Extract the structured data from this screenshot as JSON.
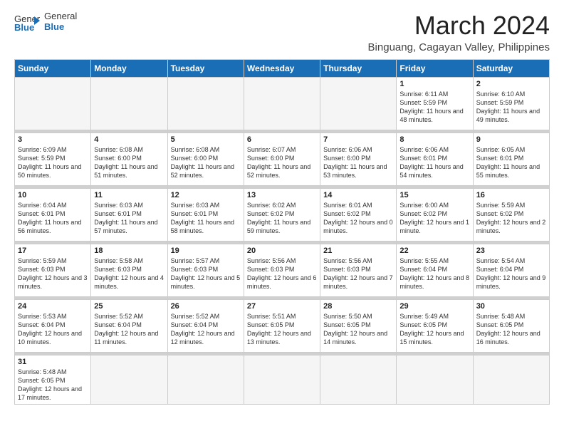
{
  "header": {
    "logo_general": "General",
    "logo_blue": "Blue",
    "month_title": "March 2024",
    "location": "Binguang, Cagayan Valley, Philippines"
  },
  "weekdays": [
    "Sunday",
    "Monday",
    "Tuesday",
    "Wednesday",
    "Thursday",
    "Friday",
    "Saturday"
  ],
  "weeks": [
    [
      {
        "day": "",
        "info": ""
      },
      {
        "day": "",
        "info": ""
      },
      {
        "day": "",
        "info": ""
      },
      {
        "day": "",
        "info": ""
      },
      {
        "day": "",
        "info": ""
      },
      {
        "day": "1",
        "info": "Sunrise: 6:11 AM\nSunset: 5:59 PM\nDaylight: 11 hours and 48 minutes."
      },
      {
        "day": "2",
        "info": "Sunrise: 6:10 AM\nSunset: 5:59 PM\nDaylight: 11 hours and 49 minutes."
      }
    ],
    [
      {
        "day": "3",
        "info": "Sunrise: 6:09 AM\nSunset: 5:59 PM\nDaylight: 11 hours and 50 minutes."
      },
      {
        "day": "4",
        "info": "Sunrise: 6:08 AM\nSunset: 6:00 PM\nDaylight: 11 hours and 51 minutes."
      },
      {
        "day": "5",
        "info": "Sunrise: 6:08 AM\nSunset: 6:00 PM\nDaylight: 11 hours and 52 minutes."
      },
      {
        "day": "6",
        "info": "Sunrise: 6:07 AM\nSunset: 6:00 PM\nDaylight: 11 hours and 52 minutes."
      },
      {
        "day": "7",
        "info": "Sunrise: 6:06 AM\nSunset: 6:00 PM\nDaylight: 11 hours and 53 minutes."
      },
      {
        "day": "8",
        "info": "Sunrise: 6:06 AM\nSunset: 6:01 PM\nDaylight: 11 hours and 54 minutes."
      },
      {
        "day": "9",
        "info": "Sunrise: 6:05 AM\nSunset: 6:01 PM\nDaylight: 11 hours and 55 minutes."
      }
    ],
    [
      {
        "day": "10",
        "info": "Sunrise: 6:04 AM\nSunset: 6:01 PM\nDaylight: 11 hours and 56 minutes."
      },
      {
        "day": "11",
        "info": "Sunrise: 6:03 AM\nSunset: 6:01 PM\nDaylight: 11 hours and 57 minutes."
      },
      {
        "day": "12",
        "info": "Sunrise: 6:03 AM\nSunset: 6:01 PM\nDaylight: 11 hours and 58 minutes."
      },
      {
        "day": "13",
        "info": "Sunrise: 6:02 AM\nSunset: 6:02 PM\nDaylight: 11 hours and 59 minutes."
      },
      {
        "day": "14",
        "info": "Sunrise: 6:01 AM\nSunset: 6:02 PM\nDaylight: 12 hours and 0 minutes."
      },
      {
        "day": "15",
        "info": "Sunrise: 6:00 AM\nSunset: 6:02 PM\nDaylight: 12 hours and 1 minute."
      },
      {
        "day": "16",
        "info": "Sunrise: 5:59 AM\nSunset: 6:02 PM\nDaylight: 12 hours and 2 minutes."
      }
    ],
    [
      {
        "day": "17",
        "info": "Sunrise: 5:59 AM\nSunset: 6:03 PM\nDaylight: 12 hours and 3 minutes."
      },
      {
        "day": "18",
        "info": "Sunrise: 5:58 AM\nSunset: 6:03 PM\nDaylight: 12 hours and 4 minutes."
      },
      {
        "day": "19",
        "info": "Sunrise: 5:57 AM\nSunset: 6:03 PM\nDaylight: 12 hours and 5 minutes."
      },
      {
        "day": "20",
        "info": "Sunrise: 5:56 AM\nSunset: 6:03 PM\nDaylight: 12 hours and 6 minutes."
      },
      {
        "day": "21",
        "info": "Sunrise: 5:56 AM\nSunset: 6:03 PM\nDaylight: 12 hours and 7 minutes."
      },
      {
        "day": "22",
        "info": "Sunrise: 5:55 AM\nSunset: 6:04 PM\nDaylight: 12 hours and 8 minutes."
      },
      {
        "day": "23",
        "info": "Sunrise: 5:54 AM\nSunset: 6:04 PM\nDaylight: 12 hours and 9 minutes."
      }
    ],
    [
      {
        "day": "24",
        "info": "Sunrise: 5:53 AM\nSunset: 6:04 PM\nDaylight: 12 hours and 10 minutes."
      },
      {
        "day": "25",
        "info": "Sunrise: 5:52 AM\nSunset: 6:04 PM\nDaylight: 12 hours and 11 minutes."
      },
      {
        "day": "26",
        "info": "Sunrise: 5:52 AM\nSunset: 6:04 PM\nDaylight: 12 hours and 12 minutes."
      },
      {
        "day": "27",
        "info": "Sunrise: 5:51 AM\nSunset: 6:05 PM\nDaylight: 12 hours and 13 minutes."
      },
      {
        "day": "28",
        "info": "Sunrise: 5:50 AM\nSunset: 6:05 PM\nDaylight: 12 hours and 14 minutes."
      },
      {
        "day": "29",
        "info": "Sunrise: 5:49 AM\nSunset: 6:05 PM\nDaylight: 12 hours and 15 minutes."
      },
      {
        "day": "30",
        "info": "Sunrise: 5:48 AM\nSunset: 6:05 PM\nDaylight: 12 hours and 16 minutes."
      }
    ],
    [
      {
        "day": "31",
        "info": "Sunrise: 5:48 AM\nSunset: 6:05 PM\nDaylight: 12 hours and 17 minutes."
      },
      {
        "day": "",
        "info": ""
      },
      {
        "day": "",
        "info": ""
      },
      {
        "day": "",
        "info": ""
      },
      {
        "day": "",
        "info": ""
      },
      {
        "day": "",
        "info": ""
      },
      {
        "day": "",
        "info": ""
      }
    ]
  ]
}
